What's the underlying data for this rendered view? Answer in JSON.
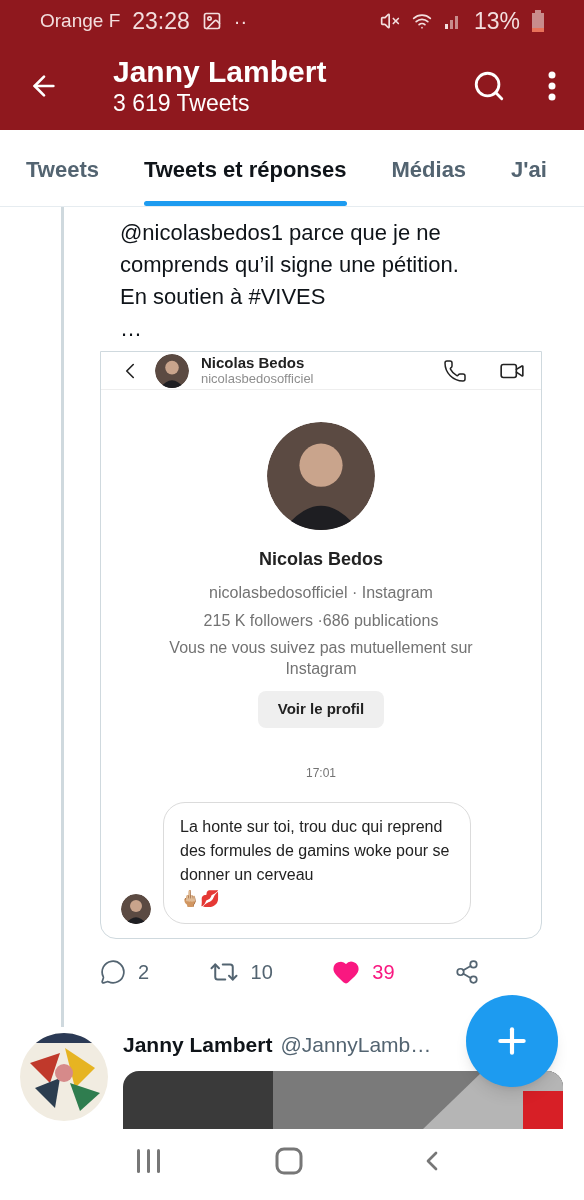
{
  "status_bar": {
    "carrier": "Orange F",
    "time": "23:28",
    "dots": "··",
    "battery": "13%"
  },
  "header": {
    "title": "Janny Lambert",
    "subtitle": "3 619 Tweets"
  },
  "tabs": [
    {
      "label": "Tweets",
      "selected": false
    },
    {
      "label": "Tweets et réponses",
      "selected": true
    },
    {
      "label": "Médias",
      "selected": false
    },
    {
      "label": "J'ai",
      "selected": false
    }
  ],
  "tweet": {
    "text_lines": [
      "@nicolasbedos1 parce que je ne",
      "comprends qu’il signe une pétition.",
      "En soutien à #VIVES",
      "…"
    ],
    "embedded": {
      "header_name": "Nicolas Bedos",
      "header_handle": "nicolasbedosofficiel",
      "profile_name": "Nicolas Bedos",
      "profile_meta": "nicolasbedosofficiel · Instagram",
      "profile_stats": "215 K followers ·686 publications",
      "profile_note": "Vous ne vous suivez pas mutuellement sur Instagram",
      "profile_button": "Voir le profil",
      "time": "17:01",
      "message": "La honte sur toi, trou duc qui reprend des formules de gamins woke pour se donner un cerveau",
      "message_emoji": "🖕🏼💋"
    },
    "actions": [
      {
        "kind": "reply",
        "count": "2",
        "active": false
      },
      {
        "kind": "retweet",
        "count": "10",
        "active": false
      },
      {
        "kind": "like",
        "count": "39",
        "active": true
      },
      {
        "kind": "share",
        "active": false
      }
    ]
  },
  "next_tweet": {
    "name": "Janny Lambert",
    "handle": "@JannyLamb…"
  }
}
